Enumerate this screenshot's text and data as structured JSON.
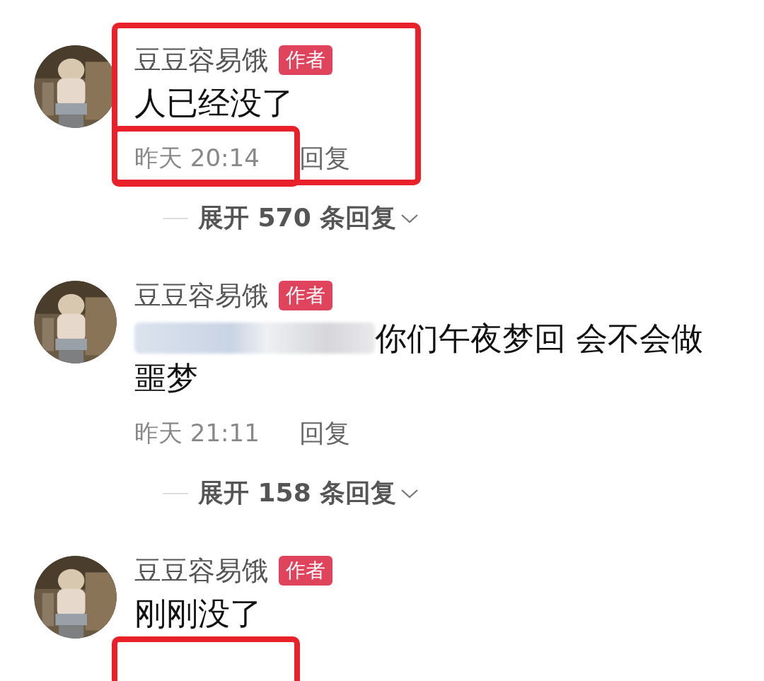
{
  "comments": [
    {
      "author": "豆豆容易饿",
      "badge": "作者",
      "text": "人已经没了",
      "redacted": false,
      "time": "昨天 20:14",
      "reply": "回复",
      "expand": "展开 570 条回复",
      "boxed": true,
      "time_boxed": true
    },
    {
      "author": "豆豆容易饿",
      "badge": "作者",
      "text": "你们午夜梦回 会不会做噩梦",
      "redacted": true,
      "time": "昨天 21:11",
      "reply": "回复",
      "expand": "展开 158 条回复",
      "boxed": false,
      "time_boxed": false
    },
    {
      "author": "豆豆容易饿",
      "badge": "作者",
      "text": "刚刚没了",
      "redacted": false,
      "boxed": false,
      "time_boxed": true
    }
  ]
}
